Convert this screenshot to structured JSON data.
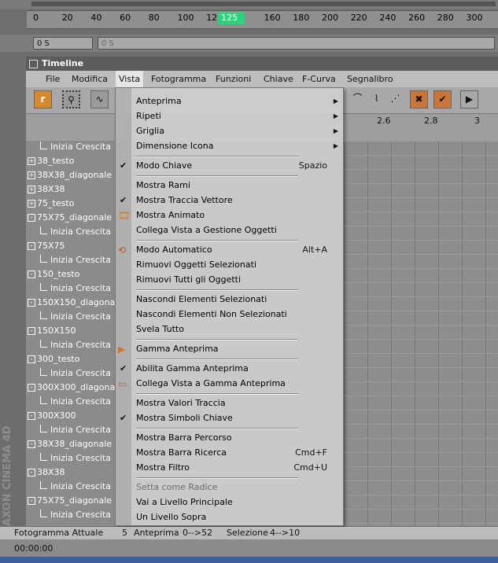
{
  "ruler": {
    "ticks": [
      "0",
      "20",
      "40",
      "60",
      "80",
      "100",
      "120",
      "",
      "160",
      "180",
      "200",
      "220",
      "240",
      "260",
      "280",
      "300"
    ],
    "cursor": "125",
    "frame_field": "0 S",
    "frame_field2": "0 S"
  },
  "timeline": {
    "title": "Timeline",
    "menus": [
      "File",
      "Modifica",
      "Vista",
      "Fotogramma",
      "Funzioni",
      "Chiave",
      "F-Curva",
      "Segnalibro"
    ],
    "time_labels": [
      "2.6",
      "2.8",
      "3"
    ]
  },
  "objects": [
    {
      "type": "track",
      "label": "Inizia Crescita"
    },
    {
      "type": "obj",
      "sign": "+",
      "label": "38_testo"
    },
    {
      "type": "obj",
      "sign": "+",
      "label": "38X38_diagonale"
    },
    {
      "type": "obj",
      "sign": "+",
      "label": "38X38"
    },
    {
      "type": "obj",
      "sign": "+",
      "label": "75_testo"
    },
    {
      "type": "obj",
      "sign": "-",
      "label": "75X75_diagonale"
    },
    {
      "type": "track",
      "label": "Inizia Crescita"
    },
    {
      "type": "obj",
      "sign": "-",
      "label": "75X75"
    },
    {
      "type": "track",
      "label": "Inizia Crescita"
    },
    {
      "type": "obj",
      "sign": "-",
      "label": "150_testo"
    },
    {
      "type": "track",
      "label": "Inizia Crescita"
    },
    {
      "type": "obj",
      "sign": "-",
      "label": "150X150_diagona"
    },
    {
      "type": "track",
      "label": "Inizia Crescita"
    },
    {
      "type": "obj",
      "sign": "-",
      "label": "150X150"
    },
    {
      "type": "track",
      "label": "Inizia Crescita"
    },
    {
      "type": "obj",
      "sign": "-",
      "label": "300_testo"
    },
    {
      "type": "track",
      "label": "Inizia Crescita"
    },
    {
      "type": "obj",
      "sign": "-",
      "label": "300X300_diagona"
    },
    {
      "type": "track",
      "label": "Inizia Crescita"
    },
    {
      "type": "obj",
      "sign": "-",
      "label": "300X300"
    },
    {
      "type": "track",
      "label": "Inizia Crescita"
    },
    {
      "type": "obj",
      "sign": "-",
      "label": "38X38_diagonale"
    },
    {
      "type": "track",
      "label": "Inizia Crescita"
    },
    {
      "type": "obj",
      "sign": "-",
      "label": "38X38"
    },
    {
      "type": "track",
      "label": "Inizia Crescita"
    },
    {
      "type": "obj",
      "sign": "-",
      "label": "75X75_diagonale"
    },
    {
      "type": "track",
      "label": "Inizia Crescita"
    }
  ],
  "menu": {
    "items": [
      {
        "label": "Anteprima",
        "arrow": true
      },
      {
        "label": "Ripeti",
        "arrow": true
      },
      {
        "label": "Griglia",
        "arrow": true
      },
      {
        "label": "Dimensione Icona",
        "arrow": true
      },
      {
        "sep": true
      },
      {
        "label": "Modo Chiave",
        "check": true,
        "shortcut": "Spazio"
      },
      {
        "sep": true
      },
      {
        "label": "Mostra Rami"
      },
      {
        "label": "Mostra Traccia Vettore",
        "check": true
      },
      {
        "label": "Mostra Animato",
        "icon": "animated-icon"
      },
      {
        "label": "Collega Vista a Gestione Oggetti"
      },
      {
        "sep": true
      },
      {
        "label": "Modo Automatico",
        "icon": "auto-mode-icon",
        "shortcut": "Alt+A"
      },
      {
        "label": "Rimuovi Oggetti Selezionati"
      },
      {
        "label": "Rimuovi Tutti gli Oggetti"
      },
      {
        "sep": true
      },
      {
        "label": "Nascondi Elementi Selezionati"
      },
      {
        "label": "Nascondi Elementi  Non Selezionati"
      },
      {
        "label": "Svela Tutto"
      },
      {
        "sep": true
      },
      {
        "label": "Gamma Anteprima",
        "icon": "preview-range-icon"
      },
      {
        "sep": true
      },
      {
        "label": "Abilita Gamma Anteprima",
        "check": true
      },
      {
        "label": "Collega Vista a Gamma Anteprima",
        "icon": "link-range-icon"
      },
      {
        "sep": true
      },
      {
        "label": "Mostra Valori Traccia"
      },
      {
        "label": "Mostra Simboli Chiave",
        "check": true
      },
      {
        "sep": true
      },
      {
        "label": "Mostra Barra Percorso"
      },
      {
        "label": "Mostra Barra Ricerca",
        "shortcut": "Cmd+F"
      },
      {
        "label": "Mostra Filtro",
        "shortcut": "Cmd+U"
      },
      {
        "sep": true
      },
      {
        "label": "Setta come Radice",
        "disabled": true
      },
      {
        "label": "Vai a Livello Principale"
      },
      {
        "label": "Un Livello Sopra"
      }
    ]
  },
  "status": {
    "frame_label": "Fotogramma Attuale",
    "frame_value": "5",
    "preview_label": "Anteprima",
    "preview_value": "0-->52",
    "selection_label": "Selezione",
    "selection_value": "4-->10"
  },
  "bottom": {
    "timecode": "00:00:00"
  },
  "branding": {
    "logo_text": "MAXON CINEMA 4D"
  }
}
